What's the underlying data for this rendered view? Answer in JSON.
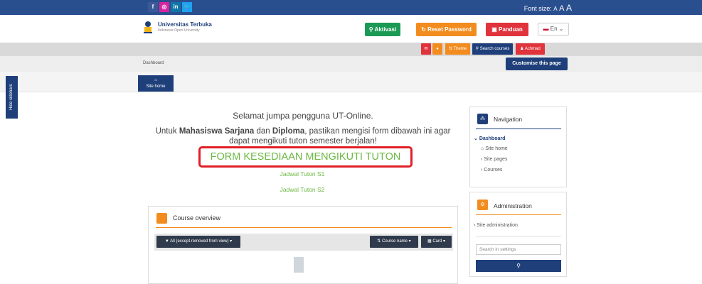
{
  "topbar": {
    "social": [
      "f",
      "◎",
      "in",
      "🐦"
    ],
    "font_size_label": "Font size:",
    "font_size_a1": "A",
    "font_size_a2": "A",
    "font_size_a3": "A"
  },
  "header": {
    "logo_title": "Universitas Terbuka",
    "logo_sub": "Indonesia Open University",
    "aktivasi": "Aktivasi",
    "reset": "Reset Password",
    "panduan": "Panduan",
    "lang": "En"
  },
  "menubar": {
    "theme": "Theme settings",
    "search": "Search courses",
    "user": "Achmad"
  },
  "breadcrumb": "Dashboard",
  "customise": "Customise this page",
  "site_home": "Site home",
  "hide_sidebars": "Hide sidebars",
  "main": {
    "welcome": "Selamat jumpa pengguna UT-Online.",
    "instr_1": "Untuk ",
    "instr_b1": "Mahasiswa Sarjana",
    "instr_2": " dan ",
    "instr_b2": "Diploma",
    "instr_3": ", pastikan mengisi form dibawah ini agar dapat mengikuti tuton semester berjalan!",
    "form_link": "FORM KESEDIAAN MENGIKUTI TUTON",
    "jadwal_1": "Jadwal Tuton S1",
    "jadwal_2": "Jadwal Tuton S2"
  },
  "course_overview": {
    "title": "Course overview",
    "filter": "All (except removed from view)",
    "sort": "Course name",
    "view": "Card"
  },
  "navigation": {
    "title": "Navigation",
    "items": [
      "Dashboard",
      "Site home",
      "Site pages",
      "Courses"
    ]
  },
  "administration": {
    "title": "Administration",
    "site_admin": "Site administration",
    "search_placeholder": "Search in settings"
  },
  "colors": {
    "brand_blue": "#1f3f7a",
    "green": "#1b9a55",
    "orange": "#f28c1e",
    "red": "#e0333c",
    "link_green": "#6cb842",
    "highlight_red": "#e01f26"
  }
}
